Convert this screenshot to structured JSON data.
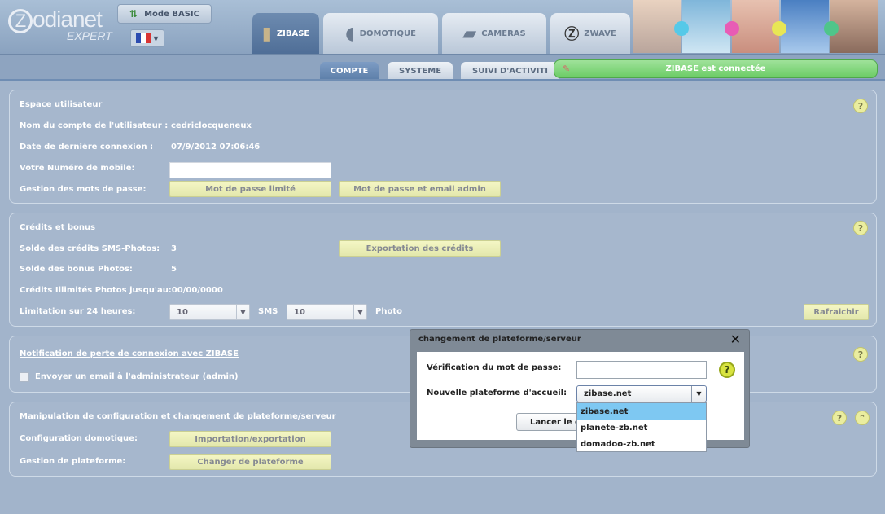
{
  "header": {
    "logo_main": "odianet",
    "logo_z": "Z",
    "logo_sub": "EXPERT",
    "mode_button": "Mode BASIC",
    "main_tabs": [
      {
        "label": "ZIBASE",
        "icon": "zibase-device-icon"
      },
      {
        "label": "DOMOTIQUE",
        "icon": "plug-icon"
      },
      {
        "label": "CAMERAS",
        "icon": "camera-icon"
      },
      {
        "label": "ZWAVE",
        "icon": "zwave-icon"
      }
    ],
    "photo_dot_colors": [
      "#55c9e8",
      "#e85cb5",
      "#e8e655",
      "#4fc58a"
    ]
  },
  "subtabs": [
    {
      "label": "COMPTE"
    },
    {
      "label": "SYSTEME"
    },
    {
      "label": "SUIVI D'ACTIVITI"
    }
  ],
  "status": "ZIBASE est connectée",
  "user_space": {
    "title": "Espace utilisateur",
    "account_label": "Nom du compte de l'utilisateur :",
    "account_value": "cedriclocqueneux",
    "lastlogin_label": "Date de dernière connexion :",
    "lastlogin_value": "07/9/2012 07:06:46",
    "mobile_label": "Votre Numéro de mobile:",
    "mobile_value": "",
    "passwords_label": "Gestion des mots de passe:",
    "btn_limited": "Mot de passe limité",
    "btn_admin": "Mot de passe et email admin"
  },
  "credits": {
    "title": "Crédits et bonus",
    "sms_label": "Solde des crédits SMS-Photos:",
    "sms_value": "3",
    "bonus_label": "Solde des bonus Photos:",
    "bonus_value": "5",
    "unlimited_label": "Crédits Illimités Photos jusqu'au:00/00/0000",
    "export_button": "Exportation des crédits",
    "limit_label": "Limitation sur 24 heures:",
    "sms_select": "10",
    "sms_unit": "SMS",
    "photo_select": "10",
    "photo_unit": "Photo",
    "refresh_button": "Rafraichir"
  },
  "notification": {
    "title": "Notification de perte de connexion avec ZIBASE",
    "checkbox_label": "Envoyer un email à l'administrateur (admin)",
    "checked": false
  },
  "config": {
    "title": "Manipulation de configuration et changement de plateforme/serveur",
    "domotic_label": "Configuration domotique:",
    "import_button": "Importation/exportation",
    "platform_label": "Gestion de plateforme:",
    "change_button": "Changer de plateforme"
  },
  "modal": {
    "title": "changement de plateforme/serveur",
    "password_label": "Vérification du mot de passe:",
    "password_value": "",
    "platform_label": "Nouvelle plateforme d'accueil:",
    "platform_selected": "zibase.net",
    "launch_button": "Lancer le c",
    "options": [
      "zibase.net",
      "planete-zb.net",
      "domadoo-zb.net"
    ]
  },
  "help_symbol": "?"
}
